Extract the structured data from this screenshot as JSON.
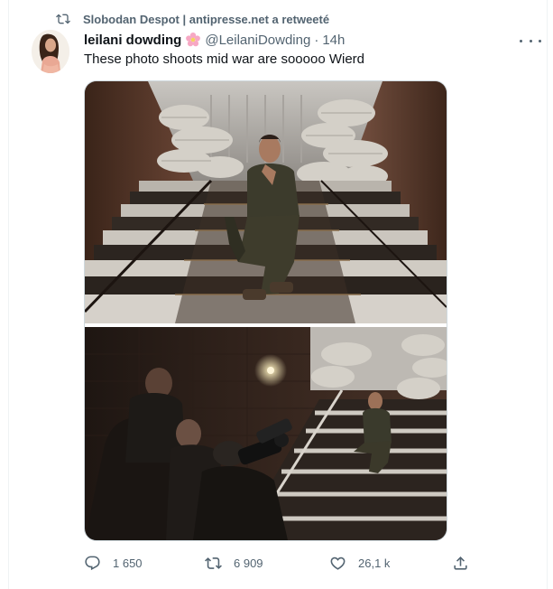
{
  "retweet": {
    "icon": "retweet-icon",
    "text": "Slobodan Despot | antipresse.net a retweeté"
  },
  "author": {
    "display_name": "leilani dowding",
    "emoji_icon": "cherry-blossom-icon",
    "handle": "@LeilaniDowding",
    "separator": "·",
    "time": "14h"
  },
  "tweet": {
    "text": "These photo shoots mid war are sooooo Wierd"
  },
  "media": {
    "photo_count": 2
  },
  "actions": {
    "reply_count": "1 650",
    "retweet_count": "6 909",
    "like_count": "26,1 k"
  },
  "colors": {
    "text_primary": "#0f1419",
    "text_secondary": "#536471",
    "border": "#cfd9de"
  }
}
